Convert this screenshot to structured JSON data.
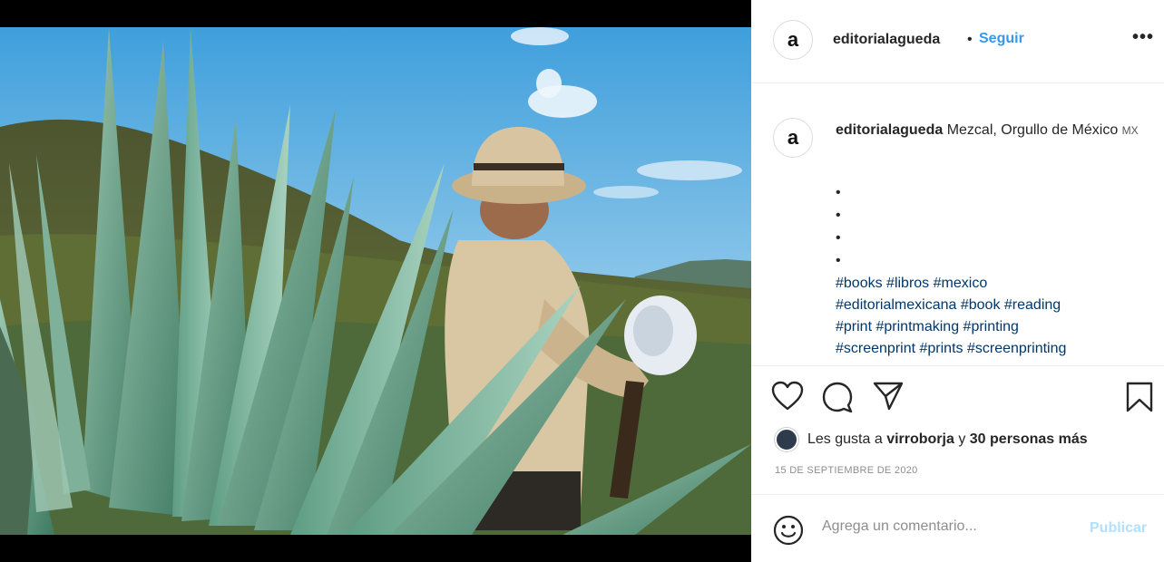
{
  "post": {
    "image_alt": "agave field with farmer holding a coa tool",
    "icon": "agave-photo"
  },
  "header": {
    "avatar_letter": "a",
    "username": "editorialagueda",
    "separator": "•",
    "follow_label": "Seguir",
    "more_label": "•••"
  },
  "caption": {
    "avatar_letter": "a",
    "username": "editorialagueda",
    "text": " Mezcal, Orgullo de México ",
    "flag": "MX",
    "bullets": [
      "•",
      "•",
      "•",
      "•"
    ],
    "hashtags": [
      [
        "#books",
        "#libros",
        "#mexico"
      ],
      [
        "#editorialmexicana",
        "#book",
        "#reading"
      ],
      [
        "#print",
        "#printmaking",
        "#printing"
      ],
      [
        "#screenprint",
        "#prints",
        "#screenprinting"
      ]
    ]
  },
  "actions": {
    "like_icon": "heart-icon",
    "comment_icon": "comment-icon",
    "share_icon": "paper-plane-icon",
    "save_icon": "bookmark-icon"
  },
  "likes": {
    "prefix": "Les gusta a ",
    "user": "virroborja",
    "middle": " y ",
    "others": "30 personas más"
  },
  "date": "15 DE SEPTIEMBRE DE 2020",
  "comment": {
    "placeholder": "Agrega un comentario...",
    "publish_label": "Publicar",
    "emoji_icon": "smiley-icon"
  },
  "colors": {
    "link_blue": "#3897f0",
    "hashtag_blue": "#00376b",
    "publish_disabled": "#b2dffc",
    "muted": "#8e8e8e"
  }
}
